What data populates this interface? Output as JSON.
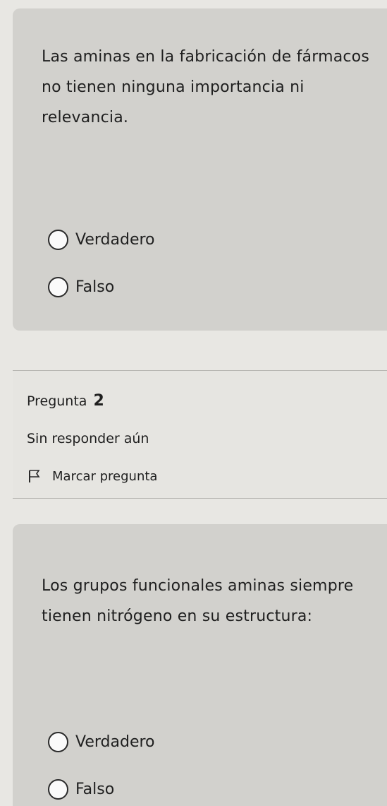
{
  "questions": [
    {
      "text": "Las aminas en la fabricación de fármacos no tienen ninguna importancia ni relevancia.",
      "options": [
        "Verdadero",
        "Falso"
      ]
    },
    {
      "text": "Los grupos funcionales aminas siempre tienen nitrógeno en su estructura:",
      "options": [
        "Verdadero",
        "Falso"
      ]
    }
  ],
  "question_info": {
    "label": "Pregunta",
    "number": "2",
    "status": "Sin responder aún",
    "flag_label": "Marcar pregunta",
    "flag_icon": "flag-icon"
  }
}
